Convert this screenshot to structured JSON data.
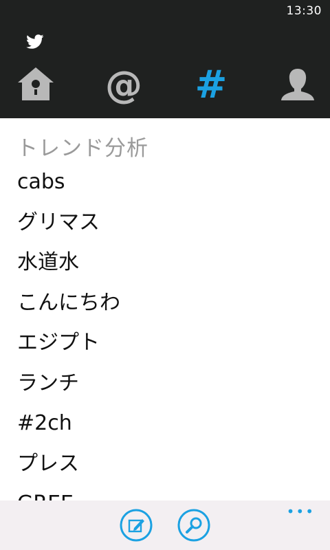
{
  "status_bar": {
    "time": "13:30"
  },
  "header": {
    "logo_icon": "twitter-bird-icon",
    "tabs": [
      {
        "id": "home",
        "icon": "home-birdhouse-icon",
        "selected": false
      },
      {
        "id": "mentions",
        "icon": "at-sign-icon",
        "glyph": "@",
        "selected": false
      },
      {
        "id": "trends",
        "icon": "hashtag-icon",
        "glyph": "#",
        "selected": true
      },
      {
        "id": "profile",
        "icon": "person-icon",
        "selected": false
      }
    ]
  },
  "colors": {
    "header_bg": "#1f2120",
    "accent": "#1ba1e2",
    "inactive_icon": "#b8b8b8",
    "appbar_bg": "#f3eff2",
    "section_title": "#9a9a9a"
  },
  "trends": {
    "title": "トレンド分析",
    "items": [
      "cabs",
      "グリマス",
      "水道水",
      "こんにちわ",
      "エジプト",
      "ランチ",
      "#2ch",
      "プレス",
      "GREE"
    ]
  },
  "app_bar": {
    "buttons": [
      {
        "id": "compose",
        "icon": "compose-icon"
      },
      {
        "id": "search",
        "icon": "search-icon"
      }
    ],
    "more": "•••"
  }
}
